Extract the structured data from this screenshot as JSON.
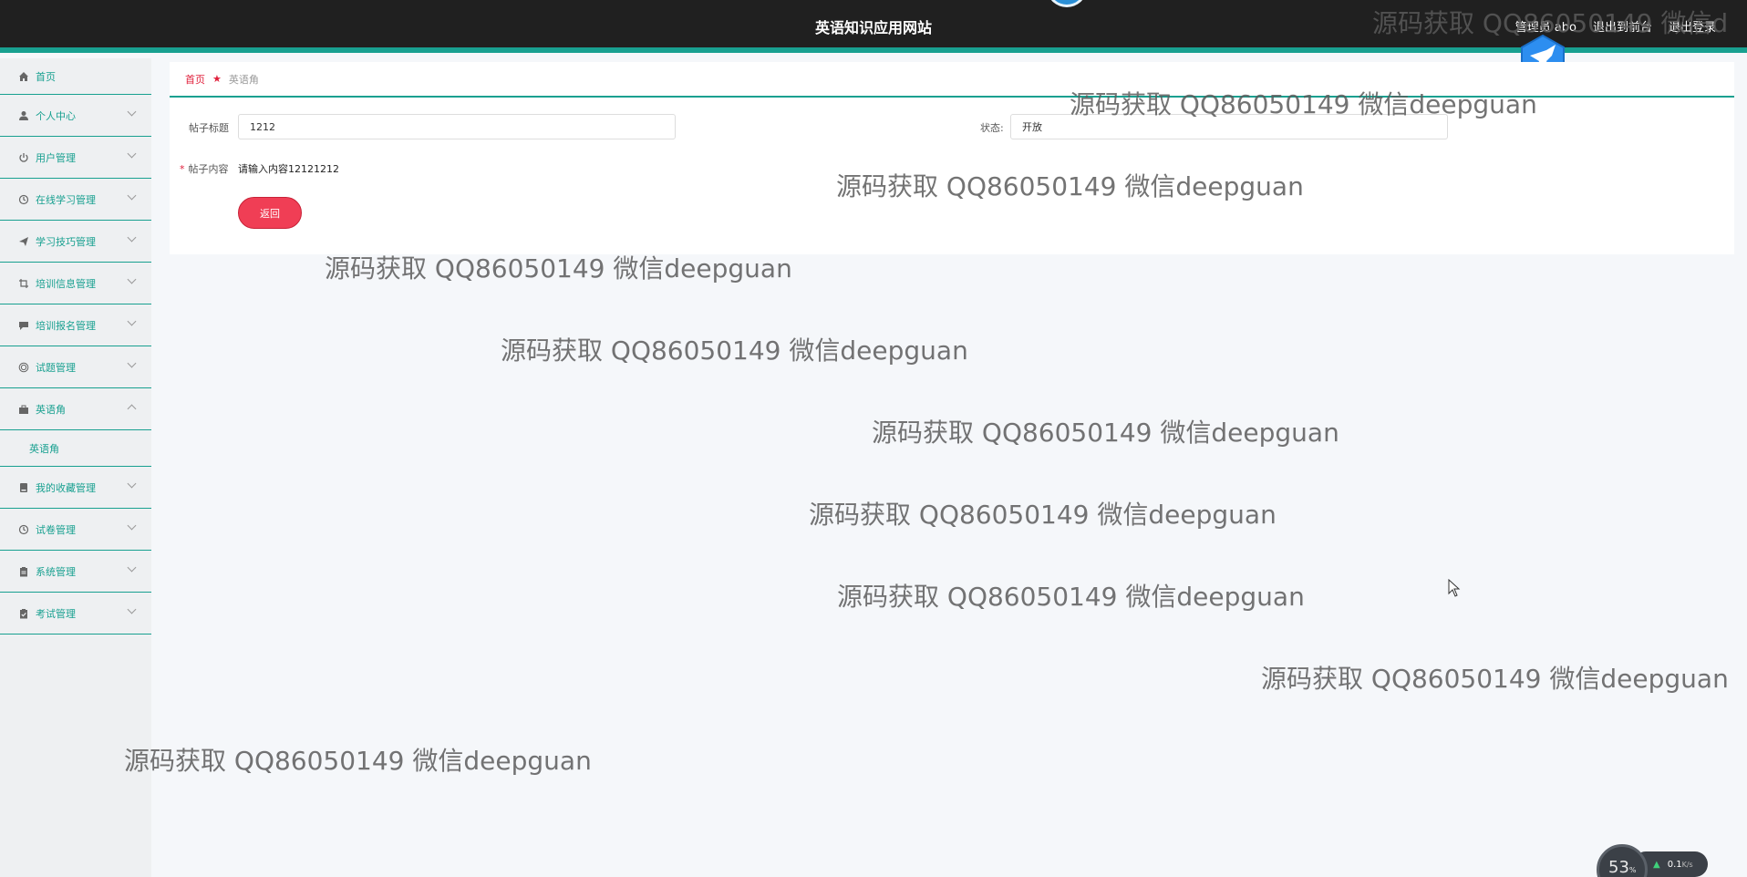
{
  "header": {
    "site_title": "英语知识应用网站",
    "user_label": "管理员 abo",
    "back_to_front": "退出到前台",
    "logout": "退出登录"
  },
  "sidebar": {
    "items": [
      {
        "label": "首页",
        "icon": "home-icon"
      },
      {
        "label": "个人中心",
        "icon": "user-icon"
      },
      {
        "label": "用户管理",
        "icon": "power-icon"
      },
      {
        "label": "在线学习管理",
        "icon": "clock-icon"
      },
      {
        "label": "学习技巧管理",
        "icon": "send-icon"
      },
      {
        "label": "培训信息管理",
        "icon": "crop-icon"
      },
      {
        "label": "培训报名管理",
        "icon": "chat-icon"
      },
      {
        "label": "试题管理",
        "icon": "target-icon"
      },
      {
        "label": "英语角",
        "icon": "briefcase-icon",
        "expanded": true
      },
      {
        "label": "我的收藏管理",
        "icon": "book-icon"
      },
      {
        "label": "试卷管理",
        "icon": "clock-icon"
      },
      {
        "label": "系统管理",
        "icon": "clipboard-icon"
      },
      {
        "label": "考试管理",
        "icon": "clipboard-check-icon"
      }
    ],
    "sub_item": "英语角"
  },
  "breadcrumb": {
    "home": "首页",
    "current": "英语角"
  },
  "form": {
    "title_label": "帖子标题",
    "title_value": "1212",
    "status_label": "状态",
    "status_value": "开放",
    "content_label": "帖子内容",
    "content_value": "请输入内容12121212",
    "back_button": "返回"
  },
  "watermark": {
    "text": "源码获取 QQ86050149 微信deepguan",
    "top_right_text": "源码获取 QQ86050149 微信d"
  },
  "network_widget": {
    "percent": "53",
    "percent_unit": "%",
    "speed": "0.1",
    "speed_unit": "K/s"
  },
  "colors": {
    "accent": "#18a090",
    "button": "#f03e55",
    "topbar": "#202020"
  }
}
